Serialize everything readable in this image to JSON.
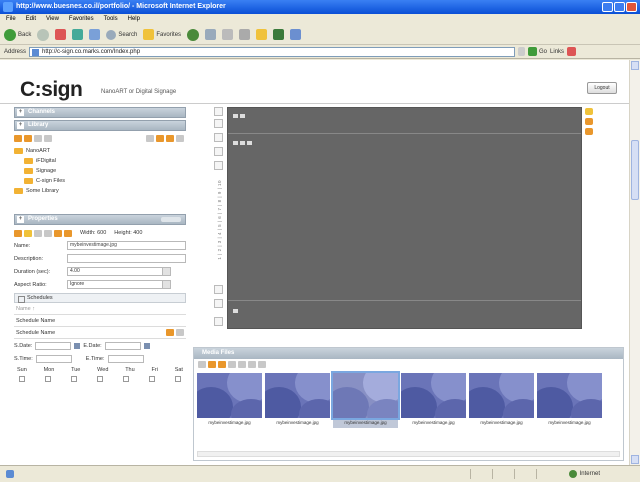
{
  "window": {
    "title": "http://www.buesnes.co.il/portfolio/ - Microsoft Internet Explorer"
  },
  "menu": [
    "File",
    "Edit",
    "View",
    "Favorites",
    "Tools",
    "Help"
  ],
  "ie_toolbar": {
    "back_label": "Back",
    "search_label": "Search",
    "favorites_label": "Favorites"
  },
  "address": {
    "label": "Address",
    "url": "http://c-sign.co.marks.com/Index.php",
    "go_label": "Go",
    "links_label": "Links"
  },
  "header": {
    "logo": "C:sign",
    "tagline": "NanoART or Digital Signage",
    "logout_label": "Logout"
  },
  "channels": {
    "title": "Channels"
  },
  "library": {
    "title": "Library",
    "tree": [
      {
        "label": "NanoART",
        "indent": 0
      },
      {
        "label": "iFDigital",
        "indent": 1
      },
      {
        "label": "Signage",
        "indent": 1
      },
      {
        "label": "C-sign Files",
        "indent": 1
      },
      {
        "label": "Some Library",
        "indent": 0
      }
    ]
  },
  "properties": {
    "title": "Properties",
    "width_label": "Width: 600",
    "height_label": "Height: 400",
    "fields": {
      "name_label": "Name:",
      "name_value": "mybeinvestimage.jpg",
      "description_label": "Description:",
      "description_value": "",
      "duration_label": "Duration (sec):",
      "duration_value": "4.00",
      "aspect_label": "Aspect Ratio:",
      "aspect_value": "Ignore"
    }
  },
  "schedules": {
    "title": "Schedules",
    "col_header": "Name ↑",
    "rows": [
      "Schedule Name",
      "Schedule Name"
    ],
    "sdate_label": "S.Date:",
    "edate_label": "E.Date:",
    "stime_label": "S.Time:",
    "etime_label": "E.Time:",
    "days": [
      "Sun",
      "Mon",
      "Tue",
      "Wed",
      "Thu",
      "Fri",
      "Sat"
    ]
  },
  "ruler_text": "1 | 2 | 3 | 4 | 5 | 6 | 7 | 8 | 9 | 10",
  "media": {
    "title": "Media Files",
    "thumbnails": [
      {
        "caption": "mybeinvestimage.jpg",
        "selected": false
      },
      {
        "caption": "mybeinvestimage.jpg",
        "selected": false
      },
      {
        "caption": "mybeinvestimage.jpg",
        "selected": true
      },
      {
        "caption": "mybeinvestimage.jpg",
        "selected": false
      },
      {
        "caption": "mybeinvestimage.jpg",
        "selected": false
      },
      {
        "caption": "mybeinvestimage.jpg",
        "selected": false
      }
    ]
  },
  "status": {
    "zone_label": "Internet"
  },
  "colors": {
    "panel_header": "#a9b6c2",
    "canvas": "#666666",
    "accent_orange": "#e9972c",
    "xp_blue": "#0a4fd6"
  }
}
